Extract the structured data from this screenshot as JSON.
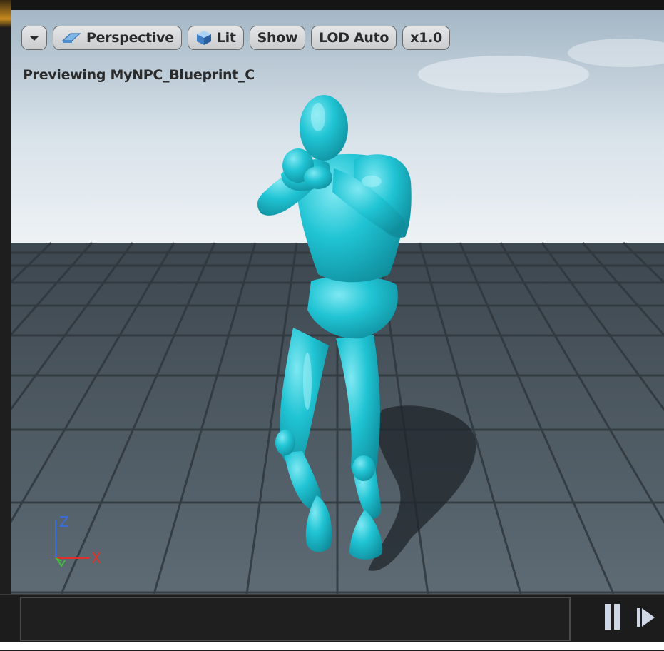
{
  "toolbar": {
    "dropdown_label": "",
    "perspective_label": "Perspective",
    "lit_label": "Lit",
    "show_label": "Show",
    "lod_label": "LOD Auto",
    "speed_label": "x1.0"
  },
  "viewport": {
    "preview_text": "Previewing MyNPC_Blueprint_C",
    "gizmo": {
      "z_label": "Z",
      "y_label": "Y",
      "x_label": "X"
    }
  },
  "colors": {
    "mannequin": "#1fc3d3",
    "sky_top": "#a9bccb",
    "floor": "#4f5d66",
    "axis_x": "#e0302a",
    "axis_y": "#3ec43a",
    "axis_z": "#3a6ee0"
  },
  "icons": {
    "dropdown": "chevron-down-icon",
    "perspective": "perspective-camera-icon",
    "lit": "lit-cube-icon",
    "pause": "pause-icon",
    "step": "step-forward-icon"
  }
}
